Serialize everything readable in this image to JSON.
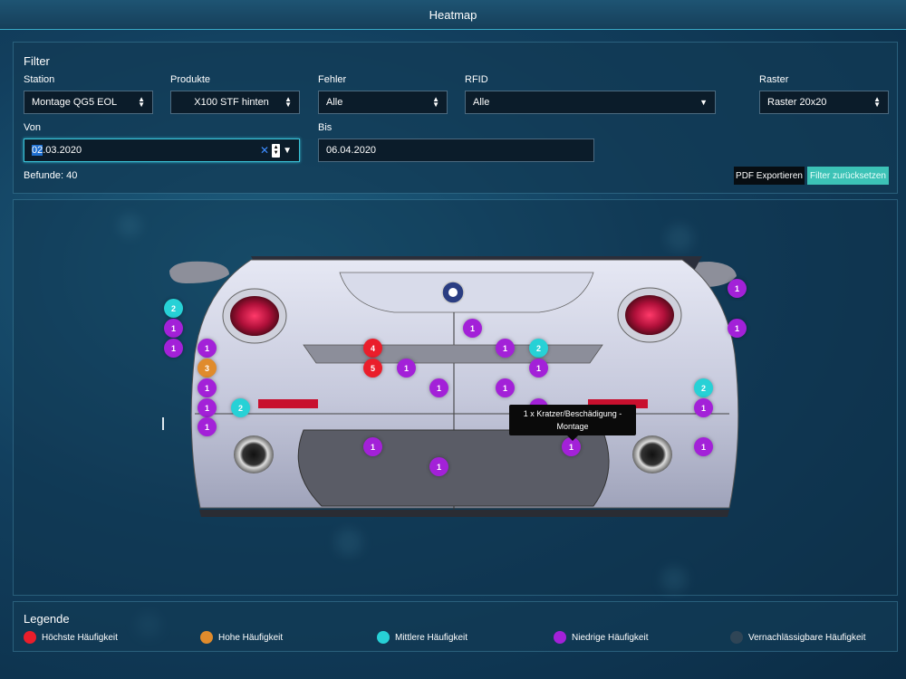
{
  "window": {
    "title": "Heatmap"
  },
  "filter": {
    "title": "Filter",
    "station": {
      "label": "Station",
      "value": "Montage QG5 EOL"
    },
    "products": {
      "label": "Produkte",
      "value": "X100 STF hinten"
    },
    "errors": {
      "label": "Fehler",
      "value": "Alle"
    },
    "rfid": {
      "label": "RFID",
      "value": "Alle"
    },
    "grid": {
      "label": "Raster",
      "value": "Raster 20x20"
    },
    "from": {
      "label": "Von",
      "value_selected": "02",
      "value_rest": ".03.2020"
    },
    "to": {
      "label": "Bis",
      "value": "06.04.2020"
    },
    "findings": "Befunde: 40",
    "export_label": "PDF Exportieren",
    "reset_label": "Filter zurücksetzen"
  },
  "heatmap": {
    "markers": [
      {
        "label": "2",
        "level": "medium"
      },
      {
        "label": "1",
        "level": "low"
      },
      {
        "label": "1",
        "level": "low"
      },
      {
        "label": "1",
        "level": "low"
      },
      {
        "label": "3",
        "level": "high"
      },
      {
        "label": "1",
        "level": "low"
      },
      {
        "label": "1",
        "level": "low"
      },
      {
        "label": "1",
        "level": "low"
      },
      {
        "label": "2",
        "level": "medium"
      },
      {
        "label": "4",
        "level": "highest"
      },
      {
        "label": "5",
        "level": "highest"
      },
      {
        "label": "1",
        "level": "low"
      },
      {
        "label": "1",
        "level": "low"
      },
      {
        "label": "1",
        "level": "low"
      },
      {
        "label": "1",
        "level": "low"
      },
      {
        "label": "1",
        "level": "low"
      },
      {
        "label": "1",
        "level": "low"
      },
      {
        "label": "1",
        "level": "low"
      },
      {
        "label": "2",
        "level": "medium"
      },
      {
        "label": "1",
        "level": "low"
      },
      {
        "label": "1",
        "level": "low"
      },
      {
        "label": "1",
        "level": "low"
      },
      {
        "label": "1",
        "level": "low"
      },
      {
        "label": "1",
        "level": "low"
      },
      {
        "label": "2",
        "level": "medium"
      },
      {
        "label": "1",
        "level": "low"
      },
      {
        "label": "1",
        "level": "low"
      }
    ],
    "tooltip": {
      "line1": "1 x Kratzer/Beschädigung -",
      "line2": "Montage"
    }
  },
  "legend": {
    "title": "Legende",
    "items": [
      {
        "label": "Höchste Häufigkeit",
        "color": "#ea1e2b"
      },
      {
        "label": "Hohe Häufigkeit",
        "color": "#e08b2c"
      },
      {
        "label": "Mittlere Häufigkeit",
        "color": "#27d1d6"
      },
      {
        "label": "Niedrige Häufigkeit",
        "color": "#a321d8"
      },
      {
        "label": "Vernachlässigbare Häufigkeit",
        "color": "#2f4556"
      }
    ]
  }
}
